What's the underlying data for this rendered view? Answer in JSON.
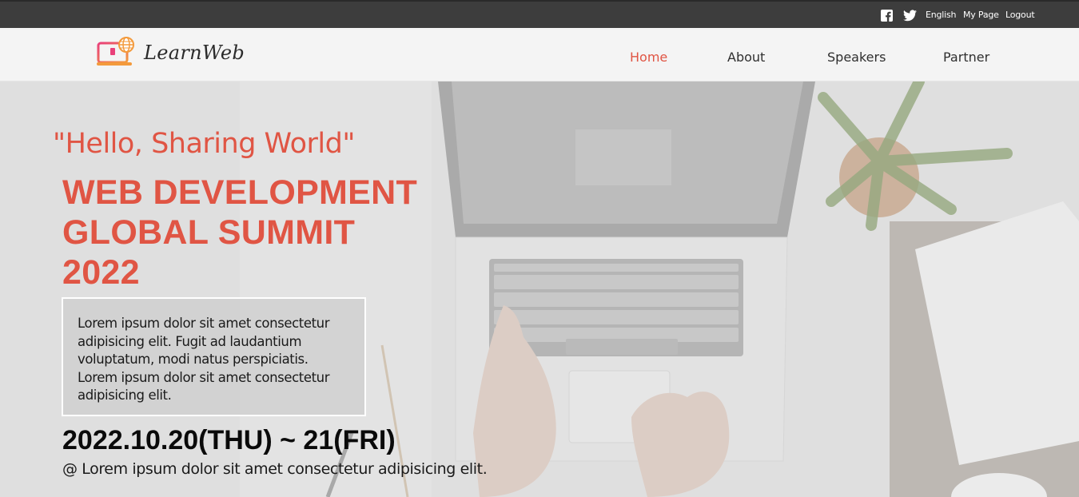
{
  "topbar": {
    "icons": [
      "facebook-icon",
      "twitter-icon"
    ],
    "links": {
      "english": "English",
      "mypage": "My Page",
      "logout": "Logout"
    }
  },
  "header": {
    "logo_text": "LearnWeb",
    "nav": {
      "home": "Home",
      "about": "About",
      "speakers": "Speakers",
      "partner": "Partner"
    },
    "active_nav": "Home"
  },
  "hero": {
    "tagline": "\"Hello, Sharing World\"",
    "title_lines": [
      "WEB DEVELOPMENT",
      "GLOBAL SUMMIT",
      "2022"
    ],
    "description": "Lorem ipsum dolor sit amet consectetur adipisicing elit. Fugit ad laudantium voluptatum, modi natus perspiciatis. Lorem ipsum dolor sit amet consectetur adipisicing elit.",
    "date": "2022.10.20(THU) ~ 21(FRI)",
    "venue": "@ Lorem ipsum dolor sit amet consectetur adipisicing elit."
  },
  "colors": {
    "accent": "#e05544",
    "topbar_bg": "#3d3d3d",
    "header_bg": "#f4f4f4"
  }
}
